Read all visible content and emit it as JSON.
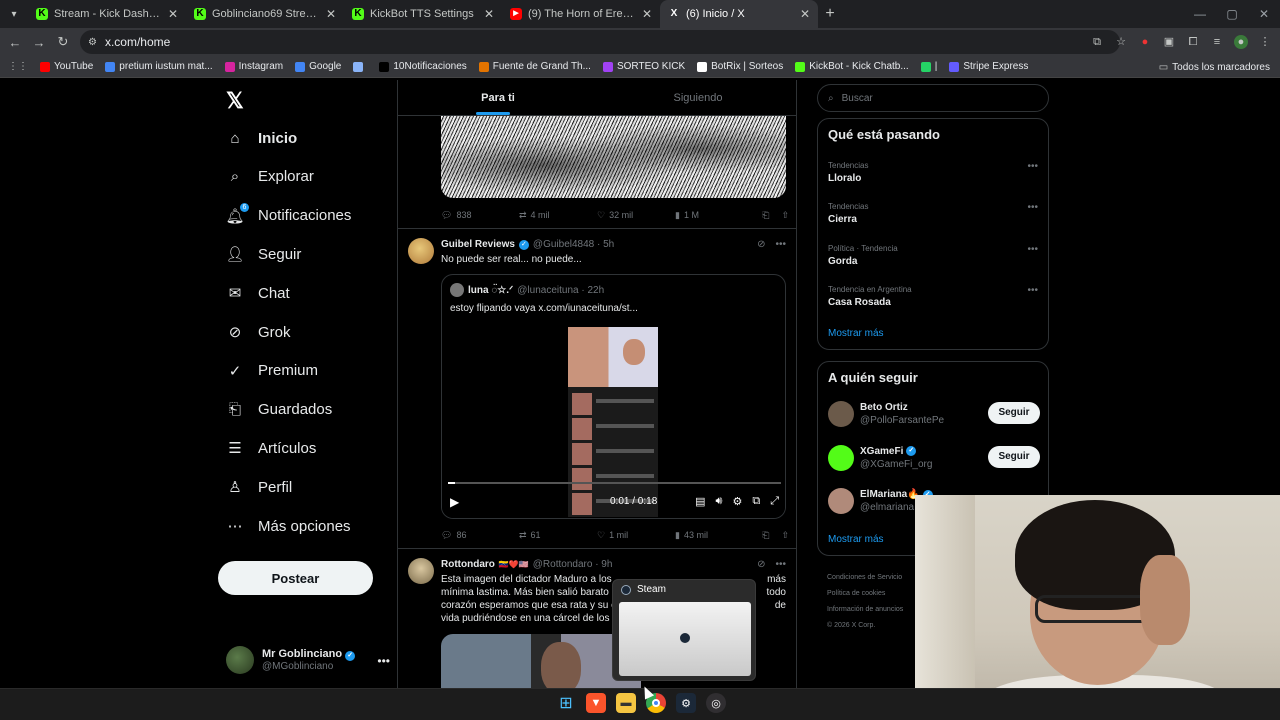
{
  "browser": {
    "tabs": [
      {
        "title": "Stream - Kick Dashboard",
        "fav_color": "#53fc18",
        "fav_glyph": "K",
        "active": false
      },
      {
        "title": "Goblinciano69 Stream - Watch",
        "fav_color": "#53fc18",
        "fav_glyph": "K",
        "active": false
      },
      {
        "title": "KickBot TTS Settings",
        "fav_color": "#53fc18",
        "fav_glyph": "K",
        "active": false
      },
      {
        "title": "(9) The Horn of Erebor | ISOLAT",
        "fav_color": "#ff0000",
        "fav_glyph": "▶",
        "active": false
      },
      {
        "title": "(6) Inicio / X",
        "fav_color": "#000000",
        "fav_glyph": "X",
        "active": true
      }
    ],
    "address": "x.com/home",
    "bookmarks": [
      {
        "label": "YouTube",
        "color": "#ff0000"
      },
      {
        "label": "pretium iustum mat...",
        "color": "#4285f4"
      },
      {
        "label": "Instagram",
        "color": "#d6249f"
      },
      {
        "label": "Google",
        "color": "#4285f4"
      },
      {
        "label": "",
        "color": "#8ab4f8"
      },
      {
        "label": "10Notificaciones",
        "color": "#000000"
      },
      {
        "label": "Fuente de Grand Th...",
        "color": "#e37400"
      },
      {
        "label": "SORTEO KICK",
        "color": "#a142f4"
      },
      {
        "label": "BotRix | Sorteos",
        "color": "#ffffff"
      },
      {
        "label": "KickBot - Kick Chatb...",
        "color": "#53fc18"
      },
      {
        "label": "|",
        "color": "#25d366"
      },
      {
        "label": "Stripe Express",
        "color": "#635bff"
      }
    ],
    "all_bookmarks": "Todos los marcadores"
  },
  "nav": {
    "items": [
      {
        "label": "Inicio",
        "icon": "home-icon",
        "glyph": "⌂",
        "active": true
      },
      {
        "label": "Explorar",
        "icon": "search-icon",
        "glyph": "⌕",
        "active": false
      },
      {
        "label": "Notificaciones",
        "icon": "bell-icon",
        "glyph": "🔔︎",
        "active": false,
        "badge": "6"
      },
      {
        "label": "Seguir",
        "icon": "person-add-icon",
        "glyph": "👤︎",
        "active": false
      },
      {
        "label": "Chat",
        "icon": "mail-icon",
        "glyph": "✉",
        "active": false
      },
      {
        "label": "Grok",
        "icon": "grok-icon",
        "glyph": "⊘",
        "active": false
      },
      {
        "label": "Premium",
        "icon": "premium-icon",
        "glyph": "✓",
        "active": false
      },
      {
        "label": "Guardados",
        "icon": "bookmark-icon",
        "glyph": "⎗",
        "active": false
      },
      {
        "label": "Artículos",
        "icon": "article-icon",
        "glyph": "☰",
        "active": false
      },
      {
        "label": "Perfil",
        "icon": "profile-icon",
        "glyph": "♙",
        "active": false
      },
      {
        "label": "Más opciones",
        "icon": "more-options-icon",
        "glyph": "⋯",
        "active": false
      }
    ],
    "post_button": "Postear",
    "account": {
      "name": "Mr Goblinciano",
      "handle": "@MGoblinciano"
    }
  },
  "feed": {
    "tabs": [
      "Para ti",
      "Siguiendo"
    ],
    "post1_stats": {
      "replies": "838",
      "reposts": "4 mil",
      "likes": "32 mil",
      "views": "1 M"
    },
    "post2": {
      "name": "Guibel Reviews",
      "handle": "@Guibel4848 · 5h",
      "text": "No puede ser real... no puede...",
      "quote": {
        "name": "luna ◌̈☆.ᐟ",
        "handle": "@lunaceituna · 22h",
        "text": "estoy flipando vaya  x.com/iunaceituna/st..."
      },
      "video_time": "0:01 / 0:18",
      "video_progress": 0.02,
      "stats": {
        "replies": "86",
        "reposts": "61",
        "likes": "1 mil",
        "views": "43 mil"
      }
    },
    "post3": {
      "name": "Rottondaro",
      "flags": "🇻🇪❤️🇺🇸",
      "handle": "@Rottondaro · 9h",
      "line1": "Esta imagen del dictador Maduro a los",
      "line1_end": "más",
      "line2": "mínima lastima. Más bien salió barato",
      "line2_end": "todo",
      "line3": "corazón esperamos que esa rata y su c",
      "line3_end": "de",
      "line4": "vida pudriéndose en una cárcel de los"
    }
  },
  "sidebar": {
    "search_placeholder": "Buscar",
    "trending_title": "Qué está pasando",
    "trends": [
      {
        "meta": "Tendencias",
        "name": "Lloralo"
      },
      {
        "meta": "Tendencias",
        "name": "Cierra"
      },
      {
        "meta": "Política · Tendencia",
        "name": "Gorda"
      },
      {
        "meta": "Tendencia en Argentina",
        "name": "Casa Rosada"
      }
    ],
    "show_more": "Mostrar más",
    "follow_title": "A quién seguir",
    "follow": [
      {
        "name": "Beto Ortiz",
        "handle": "@PolloFarsantePe",
        "button": "Seguir",
        "verified": false,
        "avatar_color": "#6b5a4a"
      },
      {
        "name": "XGameFi",
        "handle": "@XGameFi_org",
        "button": "Seguir",
        "verified": true,
        "avatar_color": "#53fc18"
      },
      {
        "name": "ElMariana🔥",
        "handle": "@elmariana",
        "button": "",
        "verified": true,
        "avatar_color": "#b08a7a"
      }
    ],
    "show_more2": "Mostrar más",
    "footer": [
      "Condiciones de Servicio",
      "Política de cookies",
      "Información de anuncios",
      "© 2026 X Corp."
    ]
  },
  "steam_popup": {
    "title": "Steam"
  }
}
